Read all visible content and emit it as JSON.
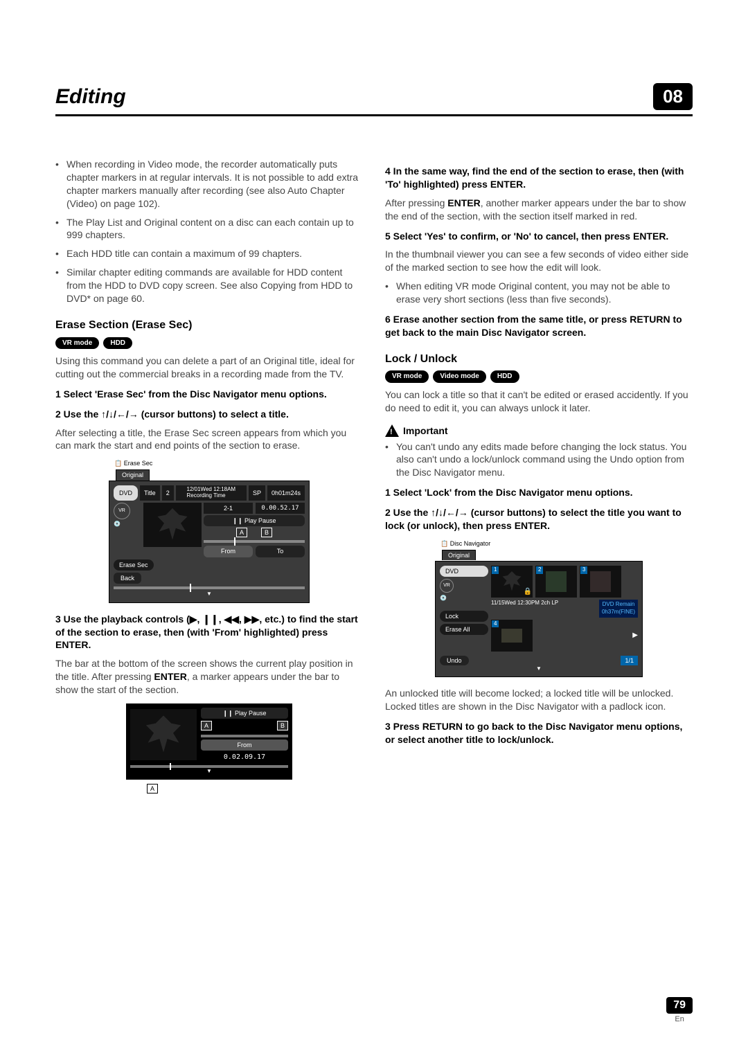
{
  "header": {
    "title": "Editing",
    "chapter": "08"
  },
  "left": {
    "bullets": [
      "When recording in Video mode, the recorder automatically puts chapter markers in at regular intervals. It is not possible to add extra chapter markers manually after recording (see also Auto Chapter (Video) on page 102).",
      "The Play List and Original content on a disc can each contain up to 999 chapters.",
      "Each HDD title can contain a maximum of 99 chapters.",
      "Similar chapter editing commands are available for HDD content from the HDD to DVD copy screen. See also Copying from HDD to DVD* on page 60."
    ],
    "erase_section_title": "Erase Section (Erase Sec)",
    "modes": [
      "VR mode",
      "HDD"
    ],
    "erase_intro": "Using this command you can delete a part of an Original title, ideal for cutting out the commercial breaks in a recording made from the TV.",
    "step1": "1    Select 'Erase Sec' from the Disc Navigator menu options.",
    "step2": "2    Use the ↑/↓/←/→ (cursor buttons) to select a title.",
    "step2_after": "After selecting a title, the Erase Sec screen appears from which you can mark the start and end points of the section to erase.",
    "step3": "3    Use the playback controls (▶, ❙❙, ◀◀, ▶▶, etc.) to find the start of the section to erase, then (with 'From' highlighted) press ENTER.",
    "step3_after_a": "The bar at the bottom of the screen shows the current play position in the title. After pressing ",
    "step3_enter": "ENTER",
    "step3_after_b": ", a marker appears under the bar to show the start of the section."
  },
  "diagram1": {
    "header": "Erase Sec",
    "tab": "Original",
    "dvd": "DVD",
    "title": "Title",
    "title_num": "2",
    "rec_time_label": "12/01Wed 12:18AM\nRecording Time",
    "sp": "SP",
    "duration": "0h01m24s",
    "chapter": "2-1",
    "timecode": "0.00.52.17",
    "playpause": "❙❙ Play Pause",
    "erase_sec": "Erase Sec",
    "from": "From",
    "to": "To",
    "back": "Back",
    "a": "A",
    "b": "B"
  },
  "diagram2": {
    "playpause": "❙❙ Play Pause",
    "a": "A",
    "b": "B",
    "from": "From",
    "timecode": "0.02.09.17"
  },
  "right": {
    "step4": "4    In the same way, find the end of the section to erase, then (with 'To' highlighted) press ENTER.",
    "step4_after_a": "After pressing ",
    "step4_enter": "ENTER",
    "step4_after_b": ", another marker appears under the bar to show the end of the section, with the section itself marked in red.",
    "step5": "5    Select 'Yes' to confirm, or 'No' to cancel, then press ENTER.",
    "step5_after": "In the thumbnail viewer you can see a few seconds of video either side of the marked section to see how the edit will look.",
    "step5_bullet": "When editing VR mode Original content, you may not be able to erase very short sections (less than five seconds).",
    "step6": "6    Erase another section from the same title, or press RETURN to get back to the main Disc Navigator screen.",
    "lock_title": "Lock / Unlock",
    "lock_modes": [
      "VR mode",
      "Video mode",
      "HDD"
    ],
    "lock_intro": "You can lock a title so that it can't be edited or erased accidently. If you do need to edit it, you can always unlock it later.",
    "important_label": "Important",
    "important_bullet": "You can't undo any edits made before changing the lock status. You also can't undo a lock/unlock command using the Undo option from the Disc Navigator menu.",
    "lock_step1": "1    Select 'Lock' from the Disc Navigator menu options.",
    "lock_step2": "2    Use the ↑/↓/←/→ (cursor buttons) to select the title you want to lock (or unlock), then press ENTER.",
    "after_diagram": "An unlocked title will become locked; a locked title will be unlocked. Locked titles are shown in the Disc Navigator with a padlock icon.",
    "lock_step3": "3    Press RETURN to go back to the Disc Navigator menu options, or select another title to lock/unlock."
  },
  "diagram3": {
    "header": "Disc Navigator",
    "tab": "Original",
    "dvd": "DVD",
    "lock": "Lock",
    "erase_all": "Erase All",
    "info": "11/15Wed 12:30PM  2ch LP",
    "remain_label": "DVD Remain",
    "remain_value": "0h37m(FINE)",
    "undo": "Undo",
    "page": "1/1",
    "thumbs": [
      "1",
      "2",
      "3",
      "4"
    ]
  },
  "footer": {
    "page": "79",
    "lang": "En"
  }
}
